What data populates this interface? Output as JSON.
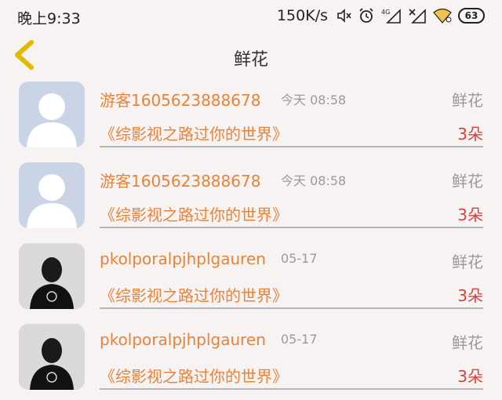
{
  "status_bar": {
    "time": "晚上9:33",
    "net_speed": "150K/s",
    "network": "4G",
    "battery": "63"
  },
  "header": {
    "back_icon": "chevron-left-icon",
    "title": "鲜花"
  },
  "colors": {
    "accent": "#e8833a",
    "count": "#d9423b",
    "back": "#e5b900"
  },
  "records": [
    {
      "avatar": "default",
      "name": "游客1605623888678",
      "time": "今天 08:58",
      "gift": "鲜花",
      "book": "《综影视之路过你的世界》",
      "count": "3朵"
    },
    {
      "avatar": "default",
      "name": "游客1605623888678",
      "time": "今天 08:58",
      "gift": "鲜花",
      "book": "《综影视之路过你的世界》",
      "count": "3朵"
    },
    {
      "avatar": "photo",
      "name": "pkolporalpjhplgauren",
      "time": "05-17",
      "gift": "鲜花",
      "book": "《综影视之路过你的世界》",
      "count": "3朵"
    },
    {
      "avatar": "photo",
      "name": "pkolporalpjhplgauren",
      "time": "05-17",
      "gift": "鲜花",
      "book": "《综影视之路过你的世界》",
      "count": "3朵"
    }
  ]
}
